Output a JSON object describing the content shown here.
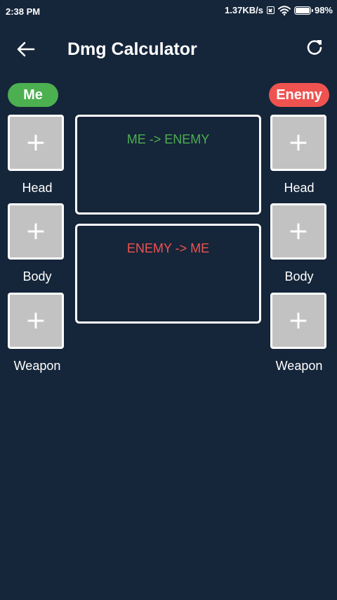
{
  "status_bar": {
    "time": "2:38 PM",
    "network_speed": "1.37KB/s",
    "battery": "98%",
    "battery_level": 0.98
  },
  "app_bar": {
    "title": "Dmg Calculator",
    "back_icon": "arrow-left-icon",
    "refresh_icon": "refresh-icon"
  },
  "me": {
    "label": "Me",
    "color": "#4caf50",
    "slots": [
      {
        "label": "Head",
        "icon": "+"
      },
      {
        "label": "Body",
        "icon": "+"
      },
      {
        "label": "Weapon",
        "icon": "+"
      }
    ]
  },
  "enemy": {
    "label": "Enemy",
    "color": "#ef5350",
    "slots": [
      {
        "label": "Head",
        "icon": "+"
      },
      {
        "label": "Body",
        "icon": "+"
      },
      {
        "label": "Weapon",
        "icon": "+"
      }
    ]
  },
  "panels": {
    "me_to_enemy": {
      "title": "ME -> ENEMY",
      "color": "#4caf50"
    },
    "enemy_to_me": {
      "title": "ENEMY -> ME",
      "color": "#ef5350"
    }
  },
  "colors": {
    "background": "#15253a",
    "slot_fill": "#c2c2c2",
    "border": "#ffffff"
  }
}
